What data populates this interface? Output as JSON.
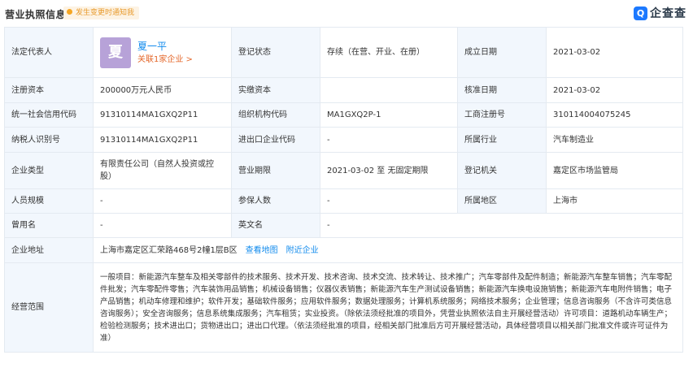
{
  "header": {
    "title": "营业执照信息",
    "notice": "发生变更时通知我",
    "brand_mark": "Q",
    "brand_text": "企查查"
  },
  "rows": {
    "r1": {
      "legal_rep_label": "法定代表人",
      "avatar_char": "夏",
      "legal_rep_name": "夏一平",
      "legal_rep_link": "关联1家企业 >",
      "reg_status_label": "登记状态",
      "reg_status_value": "存续（在营、开业、在册）",
      "founded_label": "成立日期",
      "founded_value": "2021-03-02"
    },
    "r2": {
      "reg_capital_label": "注册资本",
      "reg_capital_value": "200000万元人民币",
      "paid_capital_label": "实缴资本",
      "paid_capital_value": "",
      "approve_date_label": "核准日期",
      "approve_date_value": "2021-03-02"
    },
    "r3": {
      "credit_code_label": "统一社会信用代码",
      "credit_code_value": "91310114MA1GXQ2P11",
      "org_code_label": "组织机构代码",
      "org_code_value": "MA1GXQ2P-1",
      "biz_reg_no_label": "工商注册号",
      "biz_reg_no_value": "310114004075245"
    },
    "r4": {
      "taxpayer_id_label": "纳税人识别号",
      "taxpayer_id_value": "91310114MA1GXQ2P11",
      "import_export_label": "进出口企业代码",
      "import_export_value": "-",
      "industry_label": "所属行业",
      "industry_value": "汽车制造业"
    },
    "r5": {
      "company_type_label": "企业类型",
      "company_type_value": "有限责任公司（自然人投资或控股）",
      "biz_term_label": "营业期限",
      "biz_term_value": "2021-03-02 至 无固定期限",
      "reg_authority_label": "登记机关",
      "reg_authority_value": "嘉定区市场监管局"
    },
    "r6": {
      "staff_size_label": "人员规模",
      "staff_size_value": "-",
      "insured_label": "参保人数",
      "insured_value": "-",
      "region_label": "所属地区",
      "region_value": "上海市"
    },
    "r7": {
      "former_name_label": "曾用名",
      "former_name_value": "-",
      "english_name_label": "英文名",
      "english_name_value": "-"
    },
    "r8": {
      "address_label": "企业地址",
      "address_value": "上海市嘉定区汇荣路468号2幢1层B区",
      "map_link": "查看地图",
      "nearby_link": "附近企业"
    },
    "r9": {
      "scope_label": "经营范围",
      "scope_value": "一般项目：新能源汽车整车及相关零部件的技术服务、技术开发、技术咨询、技术交流、技术转让、技术推广；汽车零部件及配件制造；新能源汽车整车销售；汽车零配件批发；汽车零配件零售；汽车装饰用品销售；机械设备销售；仪器仪表销售；新能源汽车生产测试设备销售；新能源汽车换电设施销售；新能源汽车电附件销售；电子产品销售；机动车修理和维护；软件开发；基础软件服务；应用软件服务；数据处理服务；计算机系统服务；网络技术服务；企业管理；信息咨询服务（不含许可类信息咨询服务）；安全咨询服务；信息系统集成服务；汽车租赁；实业投资。（除依法须经批准的项目外，凭营业执照依法自主开展经营活动）许可项目：道路机动车辆生产；检验检测服务；技术进出口；货物进出口；进出口代理。（依法须经批准的项目，经相关部门批准后方可开展经营活动，具体经营项目以相关部门批准文件或许可证件为准）"
    }
  }
}
